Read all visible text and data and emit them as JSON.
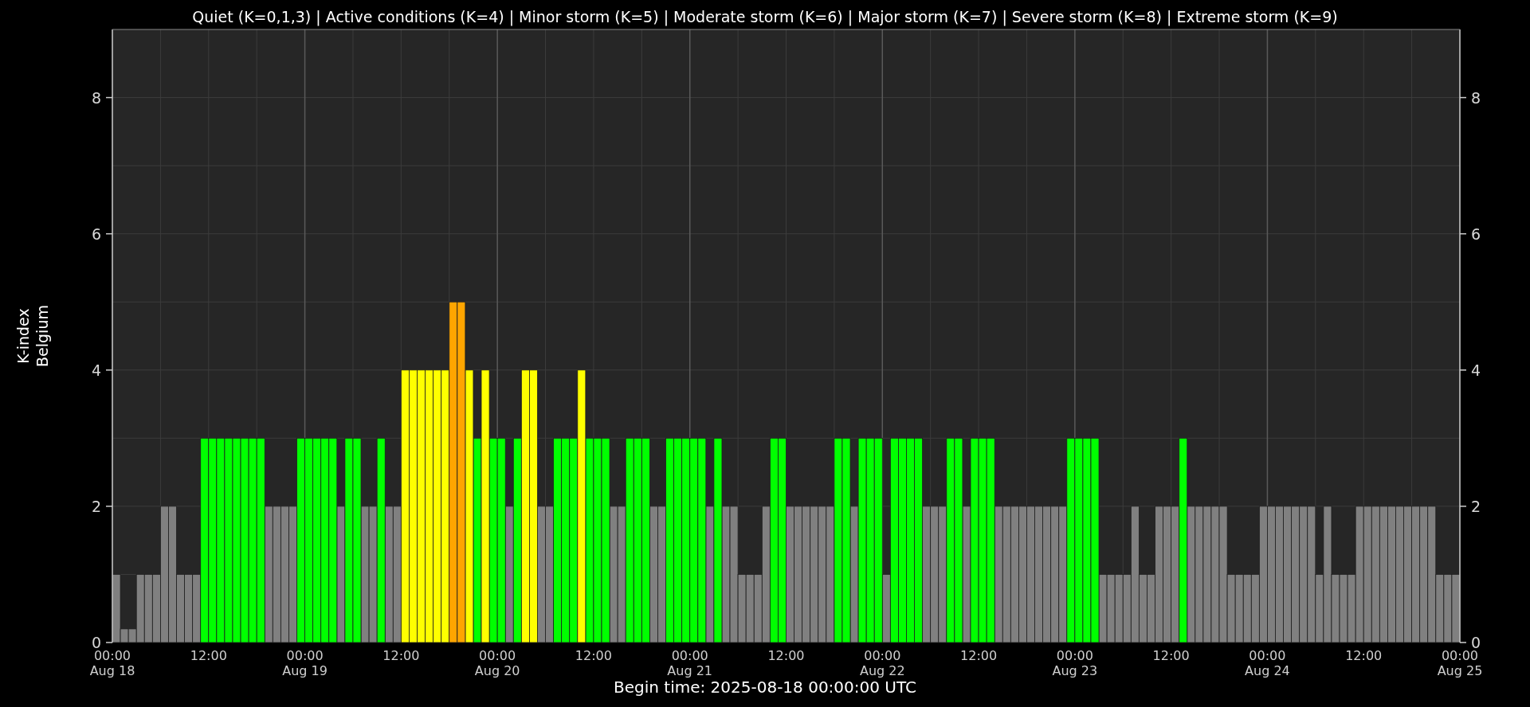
{
  "chart_data": {
    "type": "bar",
    "title": "Quiet (K=0,1,3) | Active conditions (K=4) | Minor storm (K=5) | Moderate storm (K=6) | Major storm (K=7) | Severe storm (K=8) | Extreme storm (K=9)",
    "xlabel": "Begin time: 2025-08-18 00:00:00 UTC",
    "ylabel": "K-index\nBelgium",
    "grid": true,
    "xlim": [
      "2025-08-18T00:00",
      "2025-08-25T00:00"
    ],
    "ylim": [
      0,
      9
    ],
    "xticks": [
      {
        "value": "2025-08-18T00:00",
        "label": "00:00\nAug 18"
      },
      {
        "value": "2025-08-18T12:00",
        "label": "12:00"
      },
      {
        "value": "2025-08-19T00:00",
        "label": "00:00\nAug 19"
      },
      {
        "value": "2025-08-19T12:00",
        "label": "12:00"
      },
      {
        "value": "2025-08-20T00:00",
        "label": "00:00\nAug 20"
      },
      {
        "value": "2025-08-20T12:00",
        "label": "12:00"
      },
      {
        "value": "2025-08-21T00:00",
        "label": "00:00\nAug 21"
      },
      {
        "value": "2025-08-21T12:00",
        "label": "12:00"
      },
      {
        "value": "2025-08-22T00:00",
        "label": "00:00\nAug 22"
      },
      {
        "value": "2025-08-22T12:00",
        "label": "12:00"
      },
      {
        "value": "2025-08-23T00:00",
        "label": "00:00\nAug 23"
      },
      {
        "value": "2025-08-23T12:00",
        "label": "12:00"
      },
      {
        "value": "2025-08-24T00:00",
        "label": "00:00\nAug 24"
      },
      {
        "value": "2025-08-24T12:00",
        "label": "12:00"
      },
      {
        "value": "2025-08-25T00:00",
        "label": "00:00\nAug 25"
      }
    ],
    "yticks": [
      0,
      2,
      4,
      6,
      8
    ],
    "y2ticks": [
      0,
      2,
      4,
      6,
      8
    ],
    "y2lim": [
      0,
      9
    ],
    "x": [
      "2025-08-18T00:00",
      "2025-08-18T01:00",
      "2025-08-18T02:00",
      "2025-08-18T03:00",
      "2025-08-18T04:00",
      "2025-08-18T05:00",
      "2025-08-18T06:00",
      "2025-08-18T07:00",
      "2025-08-18T08:00",
      "2025-08-18T09:00",
      "2025-08-18T10:00",
      "2025-08-18T11:00",
      "2025-08-18T12:00",
      "2025-08-18T13:00",
      "2025-08-18T14:00",
      "2025-08-18T15:00",
      "2025-08-18T16:00",
      "2025-08-18T17:00",
      "2025-08-18T18:00",
      "2025-08-18T19:00",
      "2025-08-18T20:00",
      "2025-08-18T21:00",
      "2025-08-18T22:00",
      "2025-08-18T23:00",
      "2025-08-19T00:00",
      "2025-08-19T01:00",
      "2025-08-19T02:00",
      "2025-08-19T03:00",
      "2025-08-19T04:00",
      "2025-08-19T05:00",
      "2025-08-19T06:00",
      "2025-08-19T07:00",
      "2025-08-19T08:00",
      "2025-08-19T09:00",
      "2025-08-19T10:00",
      "2025-08-19T11:00",
      "2025-08-19T12:00",
      "2025-08-19T13:00",
      "2025-08-19T14:00",
      "2025-08-19T15:00",
      "2025-08-19T16:00",
      "2025-08-19T17:00",
      "2025-08-19T18:00",
      "2025-08-19T19:00",
      "2025-08-19T20:00",
      "2025-08-19T21:00",
      "2025-08-19T22:00",
      "2025-08-19T23:00",
      "2025-08-20T00:00",
      "2025-08-20T01:00",
      "2025-08-20T02:00",
      "2025-08-20T03:00",
      "2025-08-20T04:00",
      "2025-08-20T05:00",
      "2025-08-20T06:00",
      "2025-08-20T07:00",
      "2025-08-20T08:00",
      "2025-08-20T09:00",
      "2025-08-20T10:00",
      "2025-08-20T11:00",
      "2025-08-20T12:00",
      "2025-08-20T13:00",
      "2025-08-20T14:00",
      "2025-08-20T15:00",
      "2025-08-20T16:00",
      "2025-08-20T17:00",
      "2025-08-20T18:00",
      "2025-08-20T19:00",
      "2025-08-20T20:00",
      "2025-08-20T21:00",
      "2025-08-20T22:00",
      "2025-08-20T23:00",
      "2025-08-21T00:00",
      "2025-08-21T01:00",
      "2025-08-21T02:00",
      "2025-08-21T03:00",
      "2025-08-21T04:00",
      "2025-08-21T05:00",
      "2025-08-21T06:00",
      "2025-08-21T07:00",
      "2025-08-21T08:00",
      "2025-08-21T09:00",
      "2025-08-21T10:00",
      "2025-08-21T11:00",
      "2025-08-21T12:00",
      "2025-08-21T13:00",
      "2025-08-21T14:00",
      "2025-08-21T15:00",
      "2025-08-21T16:00",
      "2025-08-21T17:00",
      "2025-08-21T18:00",
      "2025-08-21T19:00",
      "2025-08-21T20:00",
      "2025-08-21T21:00",
      "2025-08-21T22:00",
      "2025-08-21T23:00",
      "2025-08-22T00:00",
      "2025-08-22T01:00",
      "2025-08-22T02:00",
      "2025-08-22T03:00",
      "2025-08-22T04:00",
      "2025-08-22T05:00",
      "2025-08-22T06:00",
      "2025-08-22T07:00",
      "2025-08-22T08:00",
      "2025-08-22T09:00",
      "2025-08-22T10:00",
      "2025-08-22T11:00",
      "2025-08-22T12:00",
      "2025-08-22T13:00",
      "2025-08-22T14:00",
      "2025-08-22T15:00",
      "2025-08-22T16:00",
      "2025-08-22T17:00",
      "2025-08-22T18:00",
      "2025-08-22T19:00",
      "2025-08-22T20:00",
      "2025-08-22T21:00",
      "2025-08-22T22:00",
      "2025-08-22T23:00",
      "2025-08-23T00:00",
      "2025-08-23T01:00",
      "2025-08-23T02:00",
      "2025-08-23T03:00",
      "2025-08-23T04:00",
      "2025-08-23T05:00",
      "2025-08-23T06:00",
      "2025-08-23T07:00",
      "2025-08-23T08:00",
      "2025-08-23T09:00",
      "2025-08-23T10:00",
      "2025-08-23T11:00",
      "2025-08-23T12:00",
      "2025-08-23T13:00",
      "2025-08-23T14:00",
      "2025-08-23T15:00",
      "2025-08-23T16:00",
      "2025-08-23T17:00",
      "2025-08-23T18:00",
      "2025-08-23T19:00",
      "2025-08-23T20:00",
      "2025-08-23T21:00",
      "2025-08-23T22:00",
      "2025-08-23T23:00",
      "2025-08-24T00:00",
      "2025-08-24T01:00",
      "2025-08-24T02:00",
      "2025-08-24T03:00",
      "2025-08-24T04:00",
      "2025-08-24T05:00",
      "2025-08-24T06:00",
      "2025-08-24T07:00",
      "2025-08-24T08:00",
      "2025-08-24T09:00",
      "2025-08-24T10:00",
      "2025-08-24T11:00",
      "2025-08-24T12:00",
      "2025-08-24T13:00",
      "2025-08-24T14:00",
      "2025-08-24T15:00",
      "2025-08-24T16:00",
      "2025-08-24T17:00",
      "2025-08-24T18:00",
      "2025-08-24T19:00",
      "2025-08-24T20:00",
      "2025-08-24T21:00",
      "2025-08-24T22:00",
      "2025-08-24T23:00"
    ],
    "series": [
      {
        "color": "#808080",
        "values": [
          1,
          0.2,
          0.2,
          1,
          1,
          1,
          2,
          2,
          1,
          1,
          1,
          null,
          null,
          null,
          null,
          null,
          null,
          null,
          null,
          2,
          2,
          2,
          2,
          null,
          null,
          null,
          null,
          null,
          2,
          null,
          null,
          2,
          2,
          null,
          2,
          2,
          null,
          null,
          null,
          null,
          null,
          null,
          null,
          null,
          null,
          null,
          null,
          null,
          null,
          2,
          null,
          null,
          null,
          2,
          2,
          null,
          null,
          null,
          null,
          null,
          null,
          null,
          2,
          2,
          null,
          null,
          null,
          2,
          2,
          null,
          null,
          null,
          null,
          null,
          2,
          null,
          2,
          2,
          1,
          1,
          1,
          2,
          null,
          null,
          2,
          2,
          2,
          2,
          2,
          2,
          null,
          null,
          2,
          null,
          null,
          null,
          1,
          null,
          null,
          null,
          null,
          2,
          2,
          2,
          null,
          null,
          2,
          null,
          null,
          null,
          2,
          2,
          2,
          2,
          2,
          2,
          2,
          2,
          2,
          null,
          null,
          null,
          null,
          1,
          1,
          1,
          1,
          2,
          1,
          1,
          2,
          2,
          2,
          null,
          2,
          2,
          2,
          2,
          2,
          1,
          1,
          1,
          1,
          2,
          2,
          2,
          2,
          2,
          2,
          2,
          1,
          2,
          1,
          1,
          1,
          2,
          2,
          2,
          2,
          2,
          2,
          2,
          2,
          2,
          2,
          1,
          1,
          1
        ]
      },
      {
        "color": "#00ff00",
        "values": [
          null,
          null,
          null,
          null,
          null,
          null,
          null,
          null,
          null,
          null,
          null,
          3,
          3,
          3,
          3,
          3,
          3,
          3,
          3,
          null,
          null,
          null,
          null,
          3,
          3,
          3,
          3,
          3,
          null,
          3,
          3,
          null,
          null,
          3,
          null,
          null,
          null,
          null,
          null,
          null,
          null,
          null,
          null,
          null,
          null,
          3,
          null,
          3,
          3,
          null,
          3,
          null,
          null,
          null,
          null,
          3,
          3,
          3,
          null,
          3,
          3,
          3,
          null,
          null,
          3,
          3,
          3,
          null,
          null,
          3,
          3,
          3,
          3,
          3,
          null,
          3,
          null,
          null,
          null,
          null,
          null,
          null,
          3,
          3,
          null,
          null,
          null,
          null,
          null,
          null,
          3,
          3,
          null,
          3,
          3,
          3,
          null,
          3,
          3,
          3,
          3,
          null,
          null,
          null,
          3,
          3,
          null,
          3,
          3,
          3,
          null,
          null,
          null,
          null,
          null,
          null,
          null,
          null,
          null,
          3,
          3,
          3,
          3,
          null,
          null,
          null,
          null,
          null,
          null,
          null,
          null,
          null,
          null,
          3,
          null,
          null,
          null,
          null,
          null,
          null,
          null,
          null,
          null,
          null,
          null,
          null,
          null,
          null,
          null,
          null,
          null,
          null,
          null,
          null,
          null,
          null,
          null,
          null,
          null,
          null,
          null,
          null,
          null,
          null,
          null,
          null,
          null,
          null
        ]
      },
      {
        "color": "#ffff00",
        "values": [
          null,
          null,
          null,
          null,
          null,
          null,
          null,
          null,
          null,
          null,
          null,
          null,
          null,
          null,
          null,
          null,
          null,
          null,
          null,
          null,
          null,
          null,
          null,
          null,
          null,
          null,
          null,
          null,
          null,
          null,
          null,
          null,
          null,
          null,
          null,
          null,
          4,
          4,
          4,
          4,
          4,
          4,
          null,
          null,
          4,
          null,
          4,
          null,
          null,
          null,
          null,
          4,
          4,
          null,
          null,
          null,
          null,
          null,
          4,
          null,
          null,
          null,
          null,
          null,
          null,
          null,
          null,
          null,
          null,
          null,
          null,
          null,
          null,
          null,
          null,
          null,
          null,
          null,
          null,
          null,
          null,
          null,
          null,
          null,
          null,
          null,
          null,
          null,
          null,
          null,
          null,
          null,
          null,
          null,
          null,
          null,
          null,
          null,
          null,
          null,
          null,
          null,
          null,
          null,
          null,
          null,
          null,
          null,
          null,
          null,
          null,
          null,
          null,
          null,
          null,
          null,
          null,
          null,
          null,
          null,
          null,
          null,
          null,
          null,
          null,
          null,
          null,
          null,
          null,
          null,
          null,
          null,
          null,
          null,
          null,
          null,
          null,
          null,
          null,
          null,
          null,
          null,
          null,
          null,
          null,
          null,
          null,
          null,
          null,
          null,
          null,
          null,
          null,
          null,
          null,
          null,
          null,
          null,
          null,
          null,
          null,
          null,
          null,
          null,
          null,
          null,
          null,
          null
        ]
      },
      {
        "color": "#ffa500",
        "values": [
          null,
          null,
          null,
          null,
          null,
          null,
          null,
          null,
          null,
          null,
          null,
          null,
          null,
          null,
          null,
          null,
          null,
          null,
          null,
          null,
          null,
          null,
          null,
          null,
          null,
          null,
          null,
          null,
          null,
          null,
          null,
          null,
          null,
          null,
          null,
          null,
          null,
          null,
          null,
          null,
          null,
          null,
          5,
          5,
          null,
          null,
          null,
          null,
          null,
          null,
          null,
          null,
          null,
          null,
          null,
          null,
          null,
          null,
          null,
          null,
          null,
          null,
          null,
          null,
          null,
          null,
          null,
          null,
          null,
          null,
          null,
          null,
          null,
          null,
          null,
          null,
          null,
          null,
          null,
          null,
          null,
          null,
          null,
          null,
          null,
          null,
          null,
          null,
          null,
          null,
          null,
          null,
          null,
          null,
          null,
          null,
          null,
          null,
          null,
          null,
          null,
          null,
          null,
          null,
          null,
          null,
          null,
          null,
          null,
          null,
          null,
          null,
          null,
          null,
          null,
          null,
          null,
          null,
          null,
          null,
          null,
          null,
          null,
          null,
          null,
          null,
          null,
          null,
          null,
          null,
          null,
          null,
          null,
          null,
          null,
          null,
          null,
          null,
          null,
          null,
          null,
          null,
          null,
          null,
          null,
          null,
          null,
          null,
          null,
          null,
          null,
          null,
          null,
          null,
          null,
          null,
          null,
          null,
          null,
          null,
          null,
          null,
          null,
          null,
          null,
          null,
          null,
          null
        ]
      }
    ]
  }
}
